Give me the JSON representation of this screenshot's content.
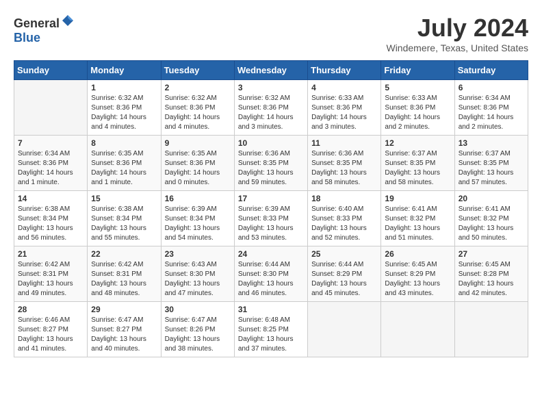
{
  "header": {
    "logo_general": "General",
    "logo_blue": "Blue",
    "month_year": "July 2024",
    "location": "Windemere, Texas, United States"
  },
  "days_of_week": [
    "Sunday",
    "Monday",
    "Tuesday",
    "Wednesday",
    "Thursday",
    "Friday",
    "Saturday"
  ],
  "weeks": [
    [
      {
        "day": "",
        "sunrise": "",
        "sunset": "",
        "daylight": ""
      },
      {
        "day": "1",
        "sunrise": "Sunrise: 6:32 AM",
        "sunset": "Sunset: 8:36 PM",
        "daylight": "Daylight: 14 hours and 4 minutes."
      },
      {
        "day": "2",
        "sunrise": "Sunrise: 6:32 AM",
        "sunset": "Sunset: 8:36 PM",
        "daylight": "Daylight: 14 hours and 4 minutes."
      },
      {
        "day": "3",
        "sunrise": "Sunrise: 6:32 AM",
        "sunset": "Sunset: 8:36 PM",
        "daylight": "Daylight: 14 hours and 3 minutes."
      },
      {
        "day": "4",
        "sunrise": "Sunrise: 6:33 AM",
        "sunset": "Sunset: 8:36 PM",
        "daylight": "Daylight: 14 hours and 3 minutes."
      },
      {
        "day": "5",
        "sunrise": "Sunrise: 6:33 AM",
        "sunset": "Sunset: 8:36 PM",
        "daylight": "Daylight: 14 hours and 2 minutes."
      },
      {
        "day": "6",
        "sunrise": "Sunrise: 6:34 AM",
        "sunset": "Sunset: 8:36 PM",
        "daylight": "Daylight: 14 hours and 2 minutes."
      }
    ],
    [
      {
        "day": "7",
        "sunrise": "Sunrise: 6:34 AM",
        "sunset": "Sunset: 8:36 PM",
        "daylight": "Daylight: 14 hours and 1 minute."
      },
      {
        "day": "8",
        "sunrise": "Sunrise: 6:35 AM",
        "sunset": "Sunset: 8:36 PM",
        "daylight": "Daylight: 14 hours and 1 minute."
      },
      {
        "day": "9",
        "sunrise": "Sunrise: 6:35 AM",
        "sunset": "Sunset: 8:36 PM",
        "daylight": "Daylight: 14 hours and 0 minutes."
      },
      {
        "day": "10",
        "sunrise": "Sunrise: 6:36 AM",
        "sunset": "Sunset: 8:35 PM",
        "daylight": "Daylight: 13 hours and 59 minutes."
      },
      {
        "day": "11",
        "sunrise": "Sunrise: 6:36 AM",
        "sunset": "Sunset: 8:35 PM",
        "daylight": "Daylight: 13 hours and 58 minutes."
      },
      {
        "day": "12",
        "sunrise": "Sunrise: 6:37 AM",
        "sunset": "Sunset: 8:35 PM",
        "daylight": "Daylight: 13 hours and 58 minutes."
      },
      {
        "day": "13",
        "sunrise": "Sunrise: 6:37 AM",
        "sunset": "Sunset: 8:35 PM",
        "daylight": "Daylight: 13 hours and 57 minutes."
      }
    ],
    [
      {
        "day": "14",
        "sunrise": "Sunrise: 6:38 AM",
        "sunset": "Sunset: 8:34 PM",
        "daylight": "Daylight: 13 hours and 56 minutes."
      },
      {
        "day": "15",
        "sunrise": "Sunrise: 6:38 AM",
        "sunset": "Sunset: 8:34 PM",
        "daylight": "Daylight: 13 hours and 55 minutes."
      },
      {
        "day": "16",
        "sunrise": "Sunrise: 6:39 AM",
        "sunset": "Sunset: 8:34 PM",
        "daylight": "Daylight: 13 hours and 54 minutes."
      },
      {
        "day": "17",
        "sunrise": "Sunrise: 6:39 AM",
        "sunset": "Sunset: 8:33 PM",
        "daylight": "Daylight: 13 hours and 53 minutes."
      },
      {
        "day": "18",
        "sunrise": "Sunrise: 6:40 AM",
        "sunset": "Sunset: 8:33 PM",
        "daylight": "Daylight: 13 hours and 52 minutes."
      },
      {
        "day": "19",
        "sunrise": "Sunrise: 6:41 AM",
        "sunset": "Sunset: 8:32 PM",
        "daylight": "Daylight: 13 hours and 51 minutes."
      },
      {
        "day": "20",
        "sunrise": "Sunrise: 6:41 AM",
        "sunset": "Sunset: 8:32 PM",
        "daylight": "Daylight: 13 hours and 50 minutes."
      }
    ],
    [
      {
        "day": "21",
        "sunrise": "Sunrise: 6:42 AM",
        "sunset": "Sunset: 8:31 PM",
        "daylight": "Daylight: 13 hours and 49 minutes."
      },
      {
        "day": "22",
        "sunrise": "Sunrise: 6:42 AM",
        "sunset": "Sunset: 8:31 PM",
        "daylight": "Daylight: 13 hours and 48 minutes."
      },
      {
        "day": "23",
        "sunrise": "Sunrise: 6:43 AM",
        "sunset": "Sunset: 8:30 PM",
        "daylight": "Daylight: 13 hours and 47 minutes."
      },
      {
        "day": "24",
        "sunrise": "Sunrise: 6:44 AM",
        "sunset": "Sunset: 8:30 PM",
        "daylight": "Daylight: 13 hours and 46 minutes."
      },
      {
        "day": "25",
        "sunrise": "Sunrise: 6:44 AM",
        "sunset": "Sunset: 8:29 PM",
        "daylight": "Daylight: 13 hours and 45 minutes."
      },
      {
        "day": "26",
        "sunrise": "Sunrise: 6:45 AM",
        "sunset": "Sunset: 8:29 PM",
        "daylight": "Daylight: 13 hours and 43 minutes."
      },
      {
        "day": "27",
        "sunrise": "Sunrise: 6:45 AM",
        "sunset": "Sunset: 8:28 PM",
        "daylight": "Daylight: 13 hours and 42 minutes."
      }
    ],
    [
      {
        "day": "28",
        "sunrise": "Sunrise: 6:46 AM",
        "sunset": "Sunset: 8:27 PM",
        "daylight": "Daylight: 13 hours and 41 minutes."
      },
      {
        "day": "29",
        "sunrise": "Sunrise: 6:47 AM",
        "sunset": "Sunset: 8:27 PM",
        "daylight": "Daylight: 13 hours and 40 minutes."
      },
      {
        "day": "30",
        "sunrise": "Sunrise: 6:47 AM",
        "sunset": "Sunset: 8:26 PM",
        "daylight": "Daylight: 13 hours and 38 minutes."
      },
      {
        "day": "31",
        "sunrise": "Sunrise: 6:48 AM",
        "sunset": "Sunset: 8:25 PM",
        "daylight": "Daylight: 13 hours and 37 minutes."
      },
      {
        "day": "",
        "sunrise": "",
        "sunset": "",
        "daylight": ""
      },
      {
        "day": "",
        "sunrise": "",
        "sunset": "",
        "daylight": ""
      },
      {
        "day": "",
        "sunrise": "",
        "sunset": "",
        "daylight": ""
      }
    ]
  ]
}
